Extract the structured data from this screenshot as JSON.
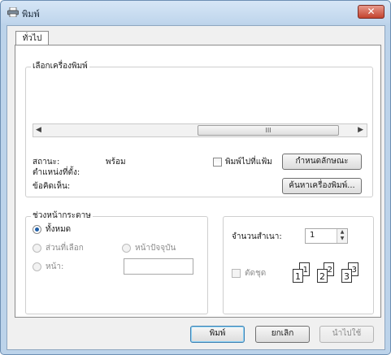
{
  "window": {
    "title": "พิมพ์",
    "close_icon": "close-icon"
  },
  "tabs": [
    {
      "label": "ทั่วไป"
    }
  ],
  "select_printer": {
    "legend": "เลือกเครื่องพิมพ์",
    "scroll_thumb": "III",
    "status_label": "สถานะ:",
    "status_value": "พร้อม",
    "location_label": "ตำแหน่งที่ตั้ง:",
    "comment_label": "ข้อคิดเห็น:",
    "print_to_file_label": "พิมพ์ไปที่แฟ้ม",
    "print_to_file_checked": false,
    "preferences_button": "กำหนดลักษณะ",
    "find_printer_button": "ค้นหาเครื่องพิมพ์..."
  },
  "page_range": {
    "legend": "ช่วงหน้ากระดาษ",
    "all_label": "ทั้งหมด",
    "all_checked": true,
    "selection_label": "ส่วนที่เลือก",
    "current_page_label": "หน้าปัจจุบัน",
    "pages_label": "หน้า:",
    "pages_value": ""
  },
  "copies": {
    "number_label": "จำนวนสำเนา:",
    "number_value": "1",
    "collate_label": "ตัดชุด",
    "collate_checked": false,
    "collate_pages": [
      [
        "1",
        "1"
      ],
      [
        "2",
        "2"
      ],
      [
        "3",
        "3"
      ]
    ]
  },
  "buttons": {
    "print": "พิมพ์",
    "cancel": "ยกเลิก",
    "apply": "นำไปใช้"
  }
}
